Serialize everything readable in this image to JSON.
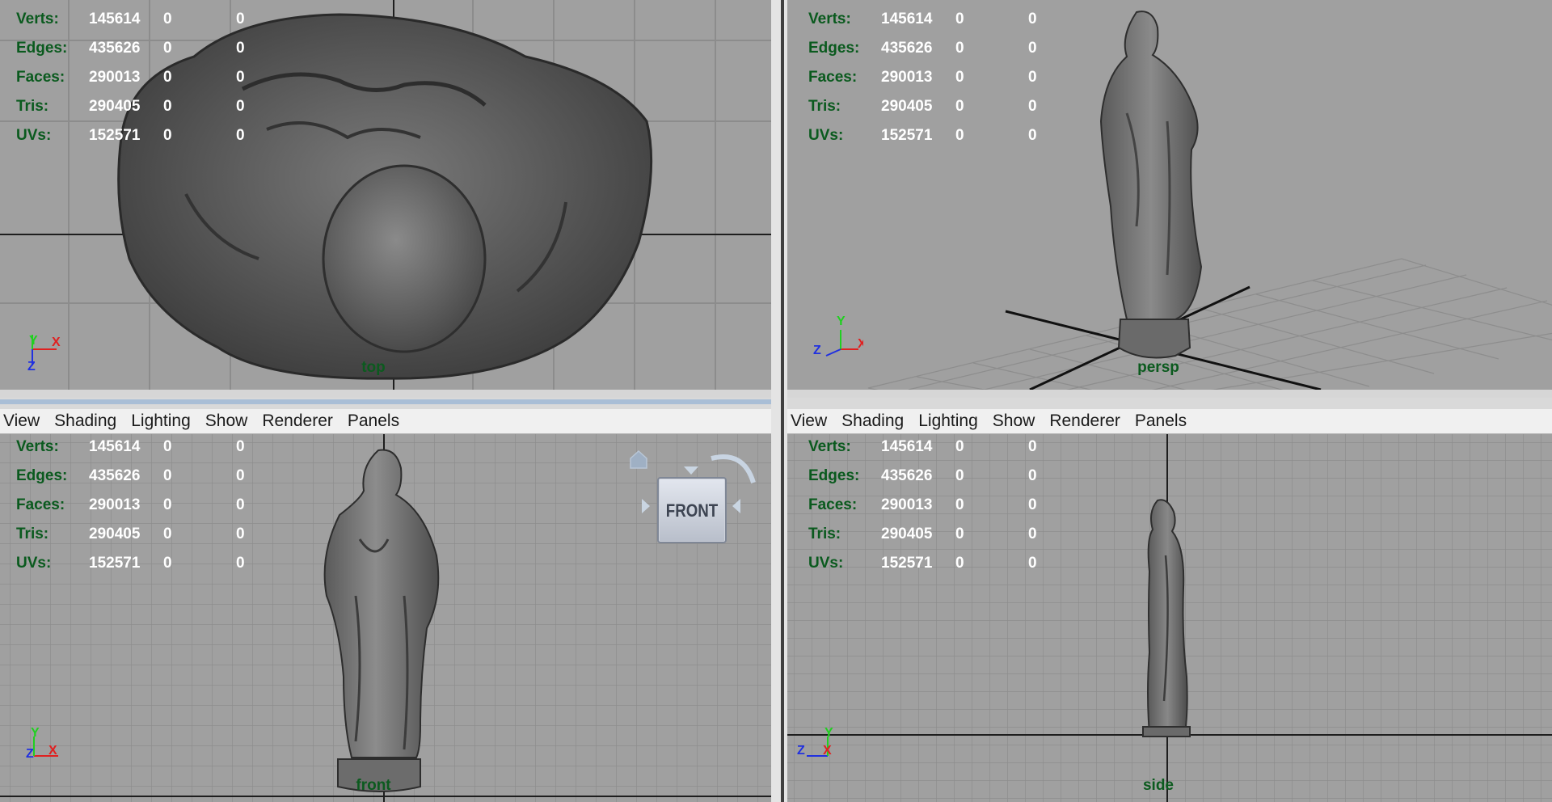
{
  "menu": [
    "View",
    "Shading",
    "Lighting",
    "Show",
    "Renderer",
    "Panels"
  ],
  "stats": [
    {
      "label": "Verts:",
      "a": "145614",
      "b": "0",
      "c": "0"
    },
    {
      "label": "Edges:",
      "a": "435626",
      "b": "0",
      "c": "0"
    },
    {
      "label": "Faces:",
      "a": "290013",
      "b": "0",
      "c": "0"
    },
    {
      "label": "Tris:",
      "a": "290405",
      "b": "0",
      "c": "0"
    },
    {
      "label": "UVs:",
      "a": "152571",
      "b": "0",
      "c": "0"
    }
  ],
  "viewports": {
    "top": {
      "camera": "top"
    },
    "persp": {
      "camera": "persp"
    },
    "front": {
      "camera": "front"
    },
    "side": {
      "camera": "side"
    }
  },
  "viewcube": {
    "label": "FRONT"
  },
  "axes": {
    "x": "X",
    "y": "Y",
    "z": "Z"
  },
  "colors": {
    "viewport_bg": "#a0a0a0",
    "hud_label": "#0a5a1e",
    "axis_x": "#e02020",
    "axis_y": "#20d020",
    "axis_z": "#2030e0"
  }
}
